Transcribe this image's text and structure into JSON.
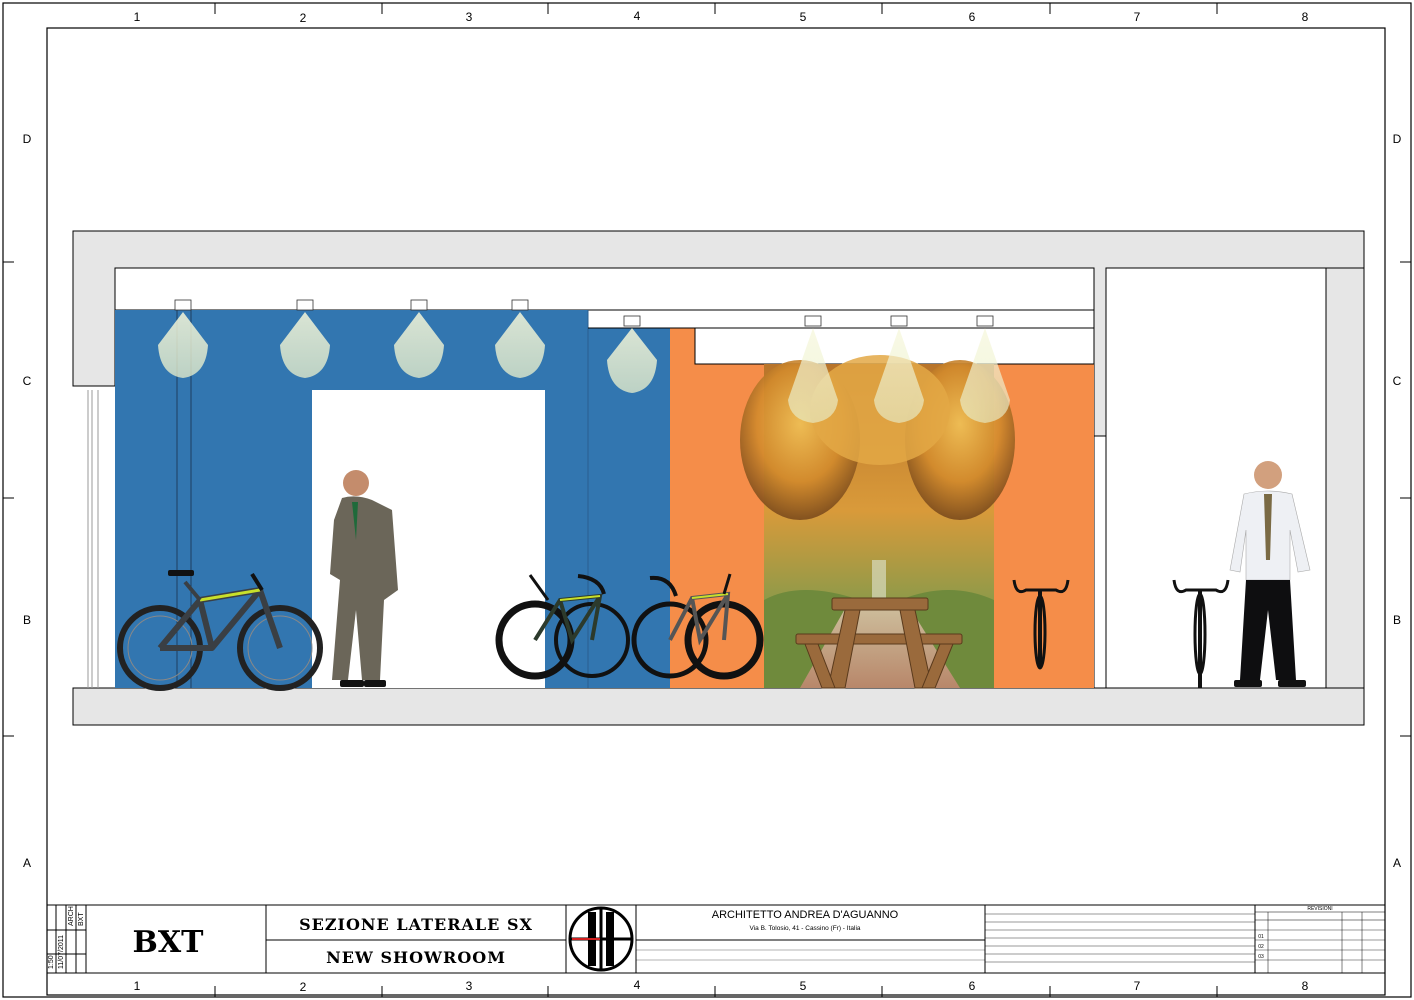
{
  "drawing": {
    "column_labels": [
      "1",
      "2",
      "3",
      "4",
      "5",
      "6",
      "7",
      "8"
    ],
    "row_labels": [
      "D",
      "C",
      "B",
      "A"
    ]
  },
  "title_block": {
    "project_code": "BXT",
    "sheet_title": "SEZIONE LATERALE SX",
    "sheet_subtitle": "NEW SHOWROOM",
    "architect": "ARCHITETTO ANDREA D'AGUANNO",
    "address": "Via B. Tolosio, 41 - Cassino (Fr) - Italia",
    "revisions_heading": "REVISIONI",
    "revision_rows": [
      "01",
      "02",
      "03"
    ],
    "side_info": [
      "1:50",
      "11/07/2011",
      "ARCH",
      "BXT"
    ]
  },
  "colors": {
    "wall_blue": "#3276b0",
    "wall_orange": "#f58d49",
    "slab_gray": "#e6e6e6",
    "frame": "#000000"
  },
  "icons": [
    "ceiling-spotlight-icon",
    "mountain-bike-icon",
    "road-bike-icon",
    "person-figure-icon",
    "picnic-table-icon",
    "architect-logo-icon"
  ]
}
